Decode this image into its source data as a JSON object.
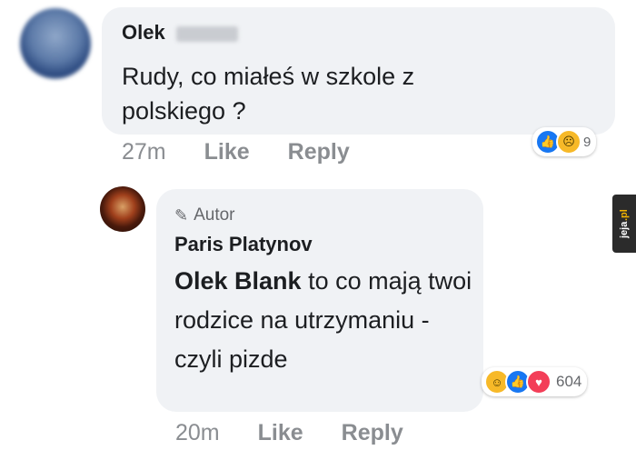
{
  "comment1": {
    "author_first": "Olek",
    "text": "Rudy, co miałeś w szkole z polskiego ?",
    "time": "27m",
    "like_label": "Like",
    "reply_label": "Reply",
    "reaction_count": "9",
    "reaction_icons": [
      "like-icon",
      "sad-icon"
    ]
  },
  "comment2": {
    "badge_label": "Autor",
    "author": "Paris Platynov",
    "mention": "Olek Blank",
    "text": " to co mają twoi rodzice na utrzymaniu - czyli pizde",
    "time": "20m",
    "like_label": "Like",
    "reply_label": "Reply",
    "reaction_count": "604",
    "reaction_icons": [
      "haha-icon",
      "like-icon",
      "love-icon"
    ]
  },
  "watermark": {
    "text_main": "jeja",
    "text_dot": ".pl"
  },
  "colors": {
    "bubble": "#f0f2f5",
    "meta": "#8a8d91",
    "like": "#1877f2",
    "love": "#f33e58",
    "haha": "#f7b928"
  }
}
